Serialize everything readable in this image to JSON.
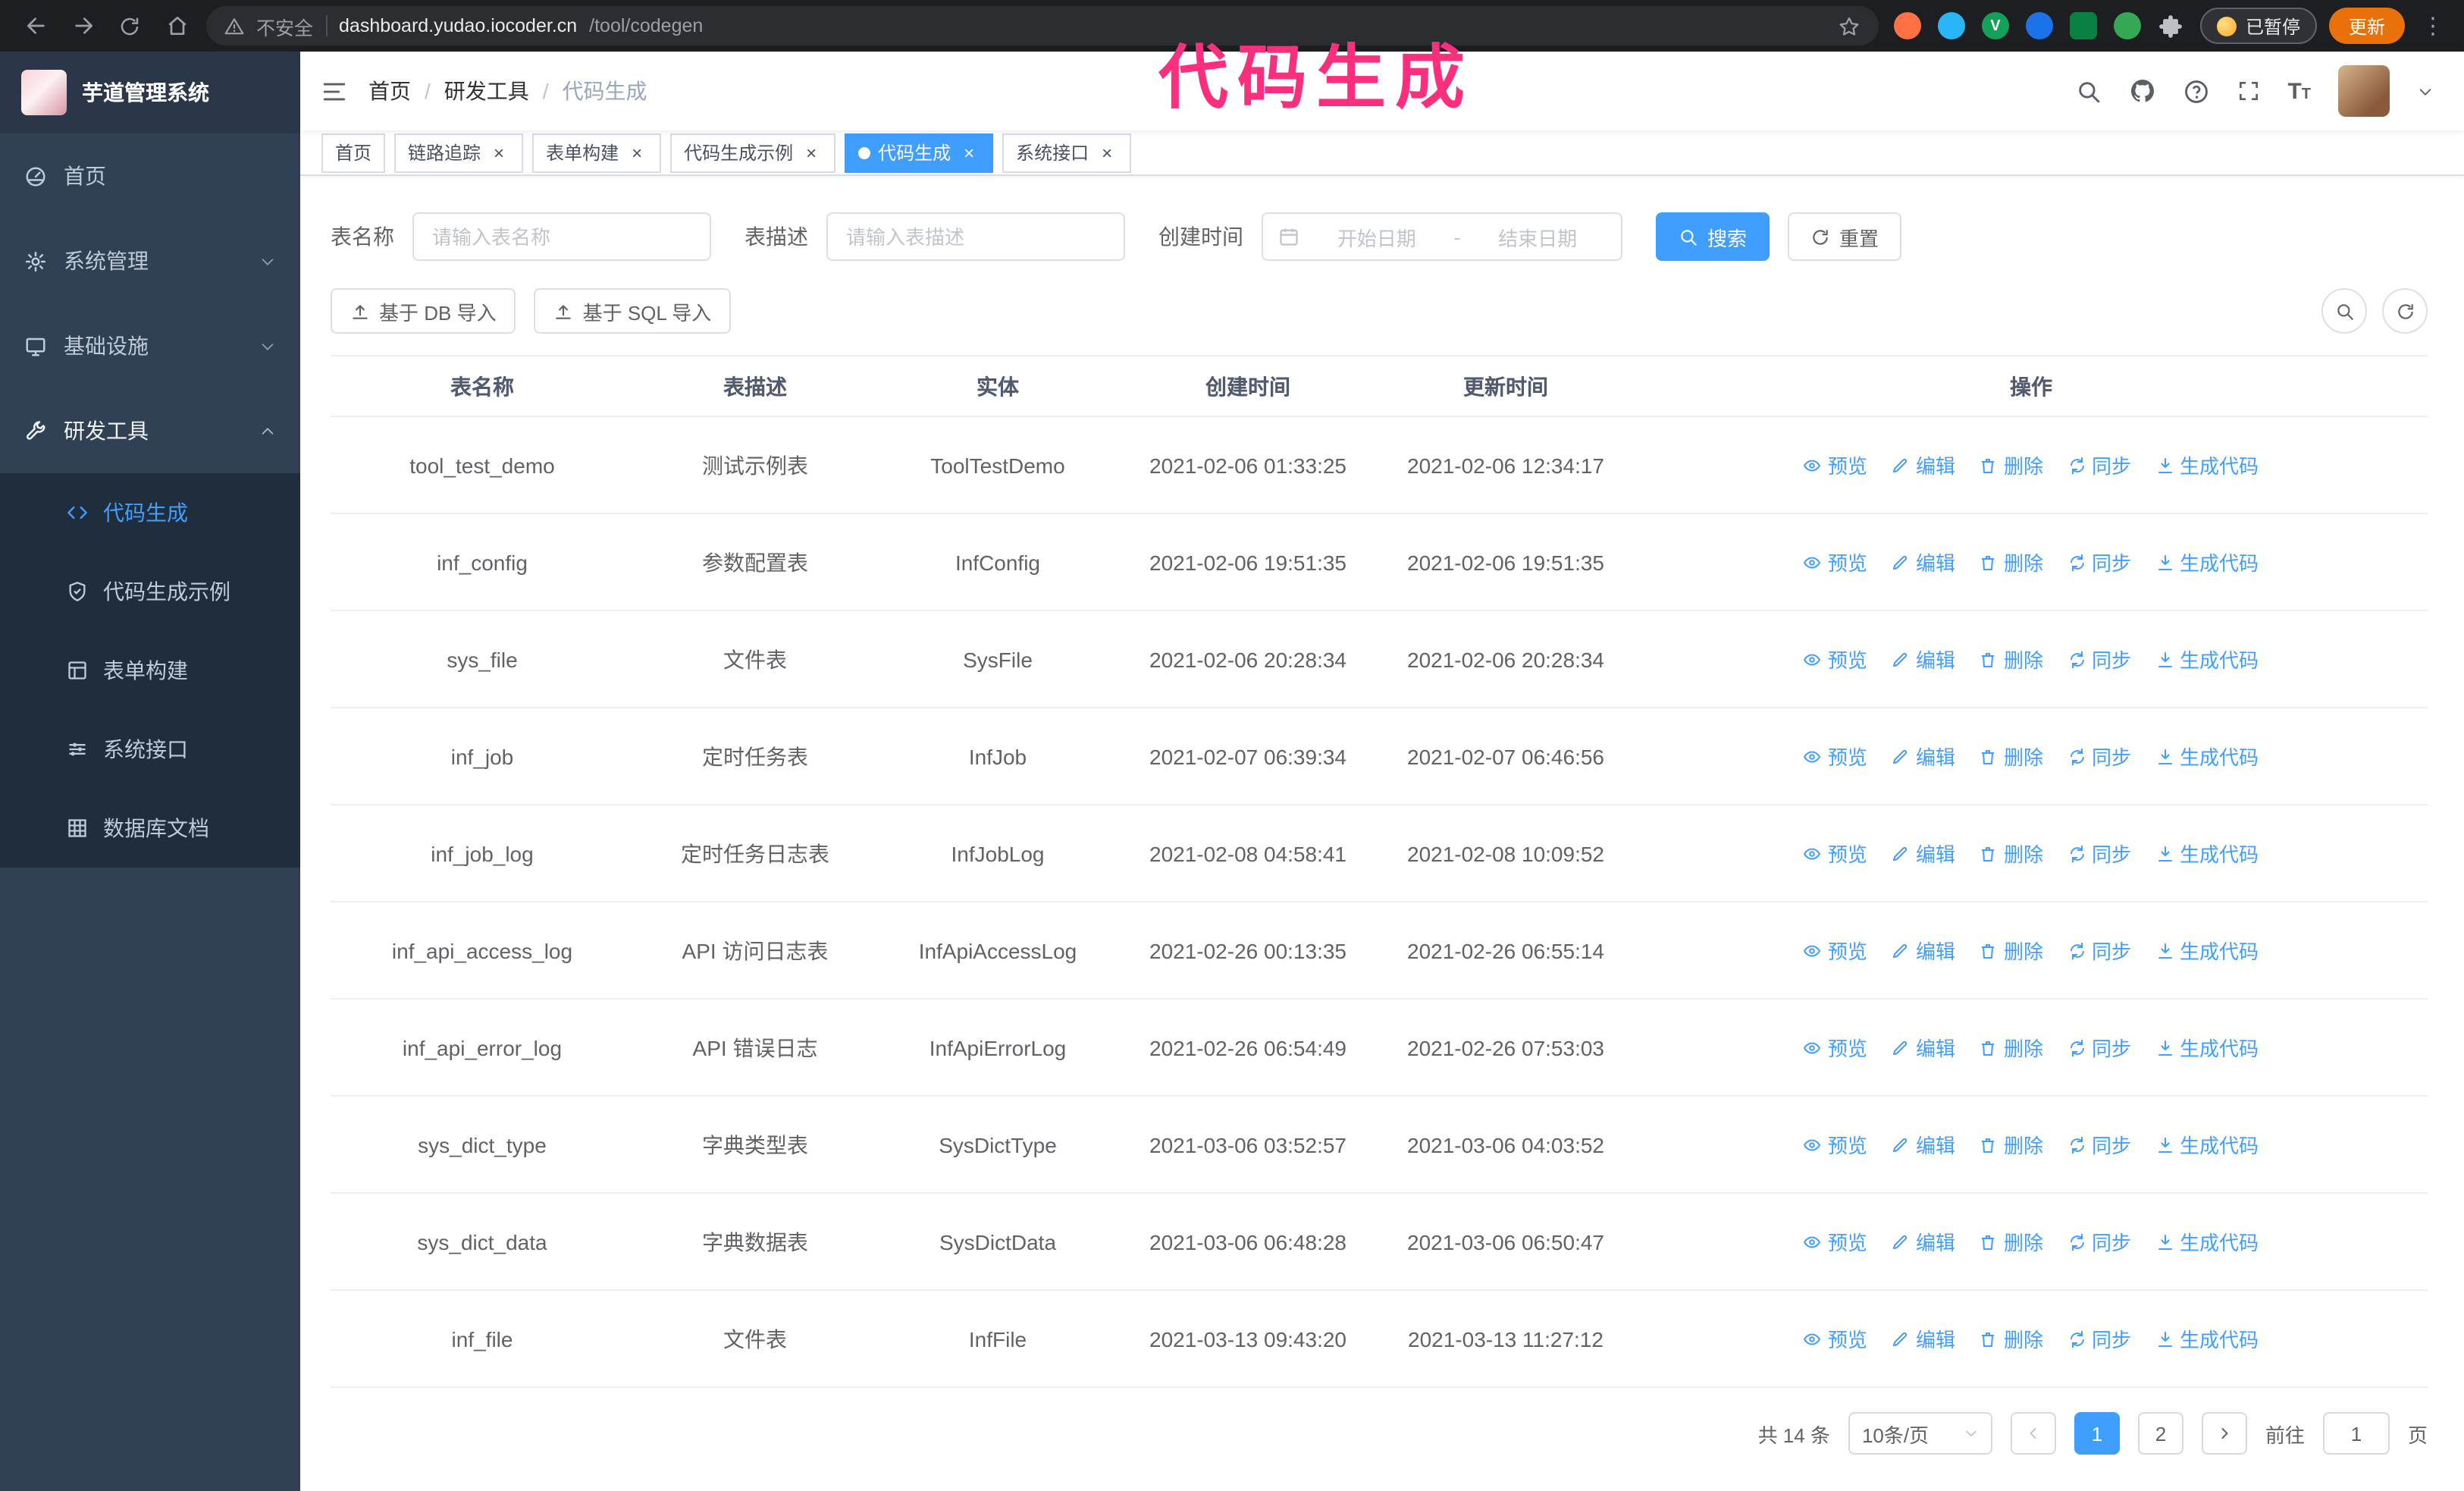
{
  "annotation": {
    "text": "代码生成",
    "color": "#fb2f7d"
  },
  "browser": {
    "security_label": "不安全",
    "url_host": "dashboard.yudao.iocoder.cn",
    "url_path": "/tool/codegen",
    "paused_badge": "已暂停",
    "update_button": "更新"
  },
  "sidebar": {
    "logo_title": "芋道管理系统",
    "items": [
      {
        "label": "首页"
      },
      {
        "label": "系统管理"
      },
      {
        "label": "基础设施"
      },
      {
        "label": "研发工具"
      }
    ],
    "subitems": [
      {
        "label": "代码生成"
      },
      {
        "label": "代码生成示例"
      },
      {
        "label": "表单构建"
      },
      {
        "label": "系统接口"
      },
      {
        "label": "数据库文档"
      }
    ]
  },
  "header": {
    "breadcrumb": [
      "首页",
      "研发工具",
      "代码生成"
    ],
    "separator": "/"
  },
  "tabs": [
    "首页",
    "链路追踪",
    "表单构建",
    "代码生成示例",
    "代码生成",
    "系统接口"
  ],
  "filters": {
    "table_name_label": "表名称",
    "table_name_placeholder": "请输入表名称",
    "table_desc_label": "表描述",
    "table_desc_placeholder": "请输入表描述",
    "create_time_label": "创建时间",
    "date_start_placeholder": "开始日期",
    "date_separator": "-",
    "date_end_placeholder": "结束日期",
    "search_button": "搜索",
    "reset_button": "重置"
  },
  "toolbar": {
    "import_db": "基于 DB 导入",
    "import_sql": "基于 SQL 导入"
  },
  "table": {
    "columns": [
      "表名称",
      "表描述",
      "实体",
      "创建时间",
      "更新时间",
      "操作"
    ],
    "actions": [
      "预览",
      "编辑",
      "删除",
      "同步",
      "生成代码"
    ],
    "rows": [
      {
        "name": "tool_test_demo",
        "desc": "测试示例表",
        "entity": "ToolTestDemo",
        "created": "2021-02-06 01:33:25",
        "updated": "2021-02-06 12:34:17"
      },
      {
        "name": "inf_config",
        "desc": "参数配置表",
        "entity": "InfConfig",
        "created": "2021-02-06 19:51:35",
        "updated": "2021-02-06 19:51:35"
      },
      {
        "name": "sys_file",
        "desc": "文件表",
        "entity": "SysFile",
        "created": "2021-02-06 20:28:34",
        "updated": "2021-02-06 20:28:34"
      },
      {
        "name": "inf_job",
        "desc": "定时任务表",
        "entity": "InfJob",
        "created": "2021-02-07 06:39:34",
        "updated": "2021-02-07 06:46:56"
      },
      {
        "name": "inf_job_log",
        "desc": "定时任务日志表",
        "entity": "InfJobLog",
        "created": "2021-02-08 04:58:41",
        "updated": "2021-02-08 10:09:52"
      },
      {
        "name": "inf_api_access_log",
        "desc": "API 访问日志表",
        "entity": "InfApiAccessLog",
        "created": "2021-02-26 00:13:35",
        "updated": "2021-02-26 06:55:14"
      },
      {
        "name": "inf_api_error_log",
        "desc": "API 错误日志",
        "entity": "InfApiErrorLog",
        "created": "2021-02-26 06:54:49",
        "updated": "2021-02-26 07:53:03"
      },
      {
        "name": "sys_dict_type",
        "desc": "字典类型表",
        "entity": "SysDictType",
        "created": "2021-03-06 03:52:57",
        "updated": "2021-03-06 04:03:52"
      },
      {
        "name": "sys_dict_data",
        "desc": "字典数据表",
        "entity": "SysDictData",
        "created": "2021-03-06 06:48:28",
        "updated": "2021-03-06 06:50:47"
      },
      {
        "name": "inf_file",
        "desc": "文件表",
        "entity": "InfFile",
        "created": "2021-03-13 09:43:20",
        "updated": "2021-03-13 11:27:12"
      }
    ]
  },
  "pagination": {
    "total": "共 14 条",
    "page_size": "10条/页",
    "pages": [
      "1",
      "2"
    ],
    "active_page": "1",
    "goto_label": "前往",
    "goto_value": "1",
    "goto_unit": "页"
  }
}
